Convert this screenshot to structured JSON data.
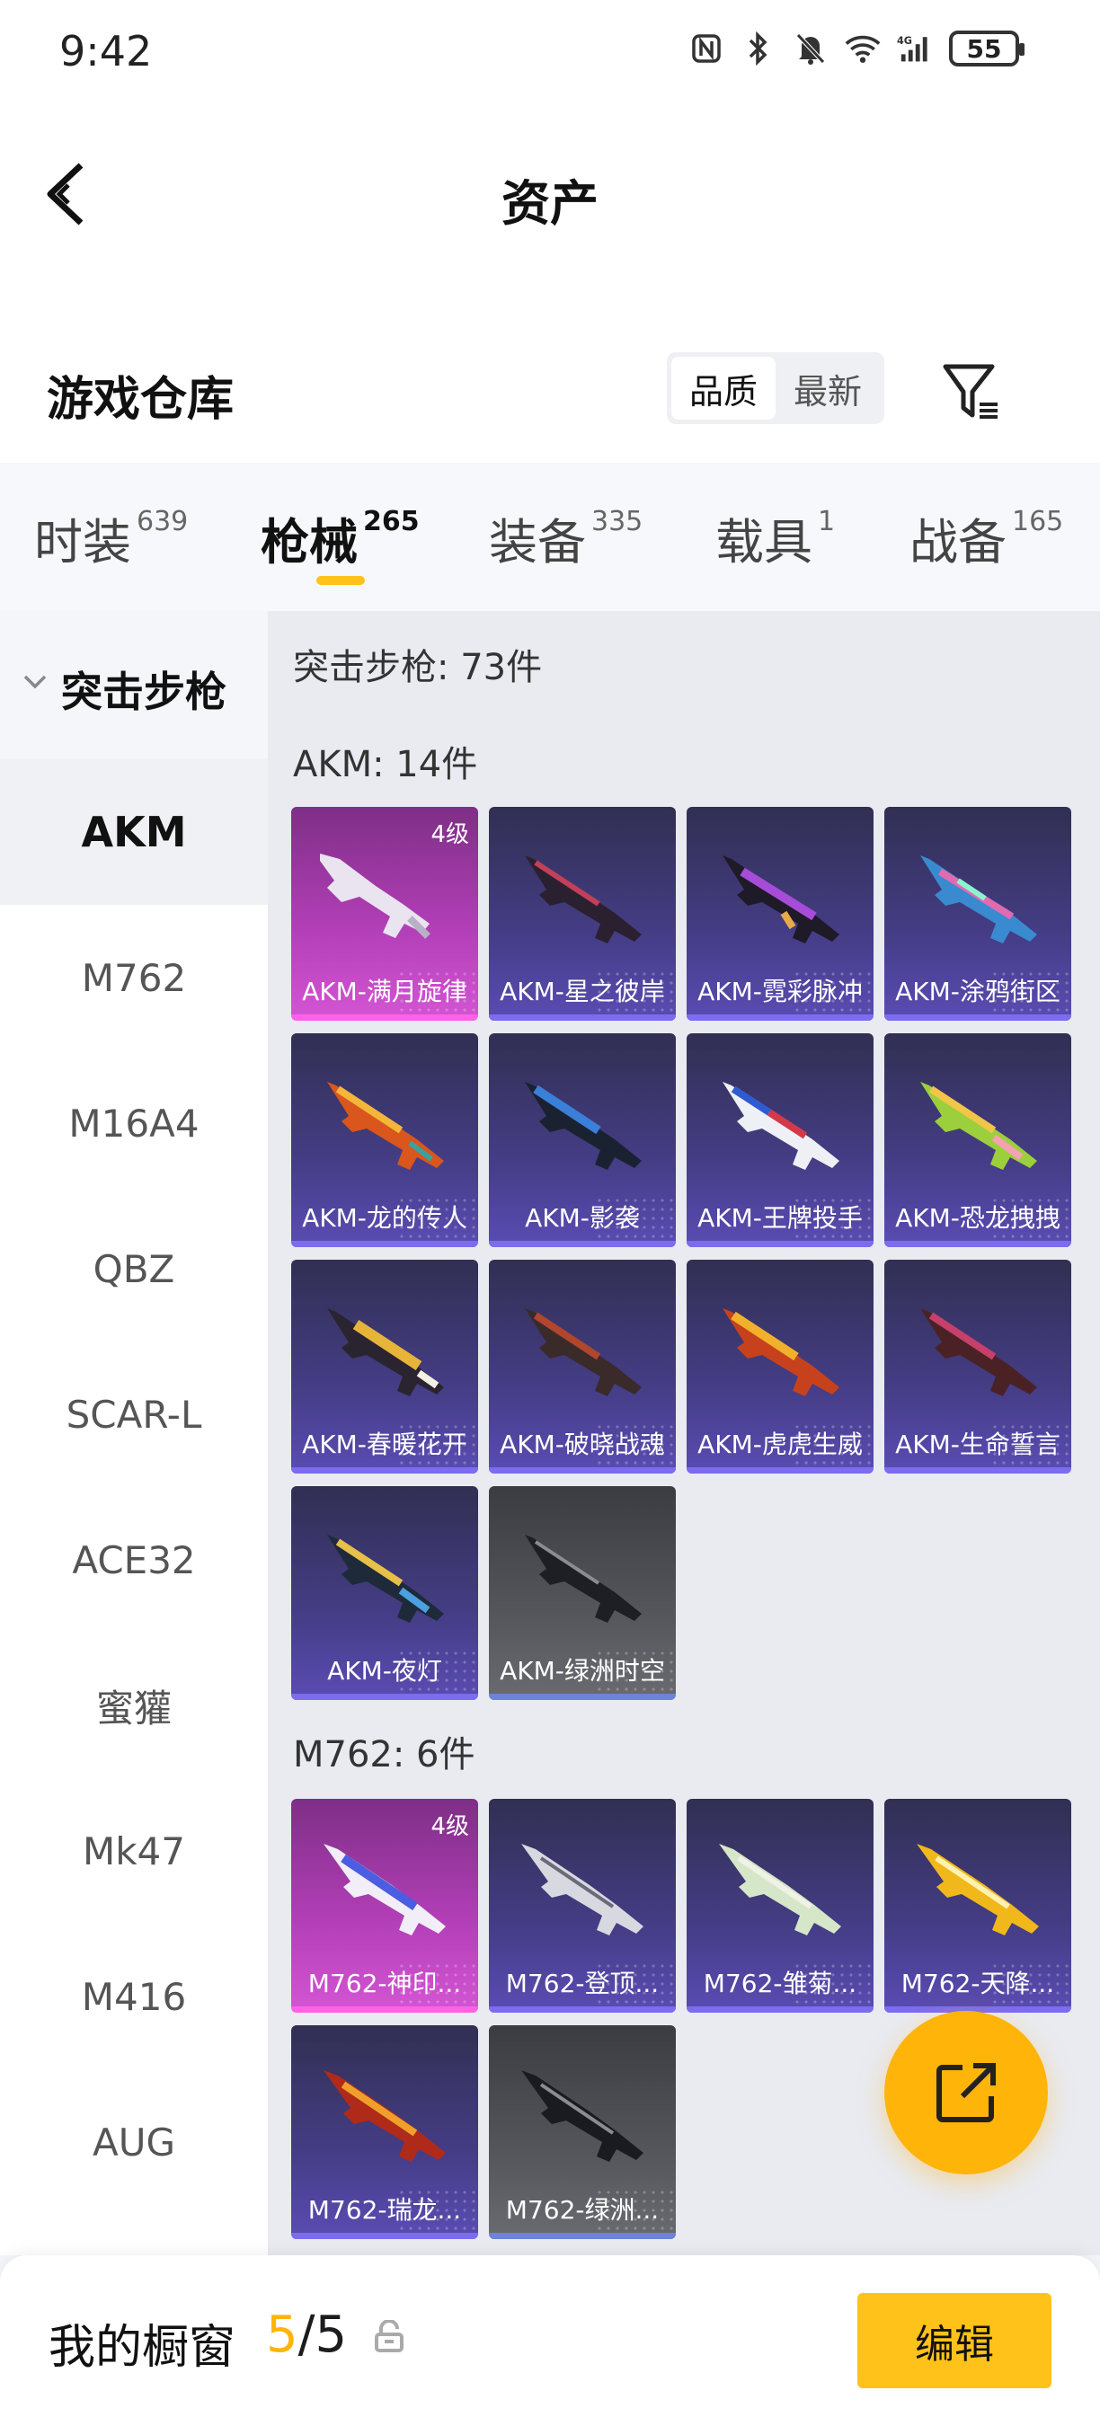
{
  "status_bar": {
    "time": "9:42",
    "battery": "55"
  },
  "header": {
    "title": "资产"
  },
  "repo": {
    "title": "游戏仓库",
    "sort_options": [
      "品质",
      "最新"
    ]
  },
  "tabs": [
    {
      "label": "时装",
      "count": "639"
    },
    {
      "label": "枪械",
      "count": "265"
    },
    {
      "label": "装备",
      "count": "335"
    },
    {
      "label": "载具",
      "count": "1"
    },
    {
      "label": "战备",
      "count": "165"
    }
  ],
  "sidebar": {
    "group": "突击步枪",
    "items": [
      "AKM",
      "M762",
      "M16A4",
      "QBZ",
      "SCAR-L",
      "ACE32",
      "蜜獾",
      "Mk47",
      "M416",
      "AUG"
    ]
  },
  "content": {
    "category_total": "突击步枪: 73件",
    "sections": [
      {
        "header": "AKM: 14件",
        "items": [
          {
            "name": "AKM-满月旋律",
            "level": "4级"
          },
          {
            "name": "AKM-星之彼岸"
          },
          {
            "name": "AKM-霓彩脉冲"
          },
          {
            "name": "AKM-涂鸦街区"
          },
          {
            "name": "AKM-龙的传人"
          },
          {
            "name": "AKM-影袭"
          },
          {
            "name": "AKM-王牌投手"
          },
          {
            "name": "AKM-恐龙拽拽"
          },
          {
            "name": "AKM-春暖花开"
          },
          {
            "name": "AKM-破晓战魂"
          },
          {
            "name": "AKM-虎虎生威"
          },
          {
            "name": "AKM-生命誓言"
          },
          {
            "name": "AKM-夜灯"
          },
          {
            "name": "AKM-绿洲时空"
          }
        ]
      },
      {
        "header": "M762: 6件",
        "items": [
          {
            "name": "M762-神印...",
            "level": "4级"
          },
          {
            "name": "M762-登顶..."
          },
          {
            "name": "M762-雏菊..."
          },
          {
            "name": "M762-天降..."
          },
          {
            "name": "M762-瑞龙..."
          },
          {
            "name": "M762-绿洲..."
          }
        ]
      }
    ]
  },
  "showcase": {
    "label": "我的橱窗",
    "current": "5",
    "total": "/5",
    "edit_label": "编辑"
  },
  "colors": {
    "accent": "#ffc21a",
    "fab": "#ffb40a",
    "rare_purple": "#5a4cb4",
    "legendary_pink": "#d455d4",
    "common_gray": "#55565c"
  }
}
